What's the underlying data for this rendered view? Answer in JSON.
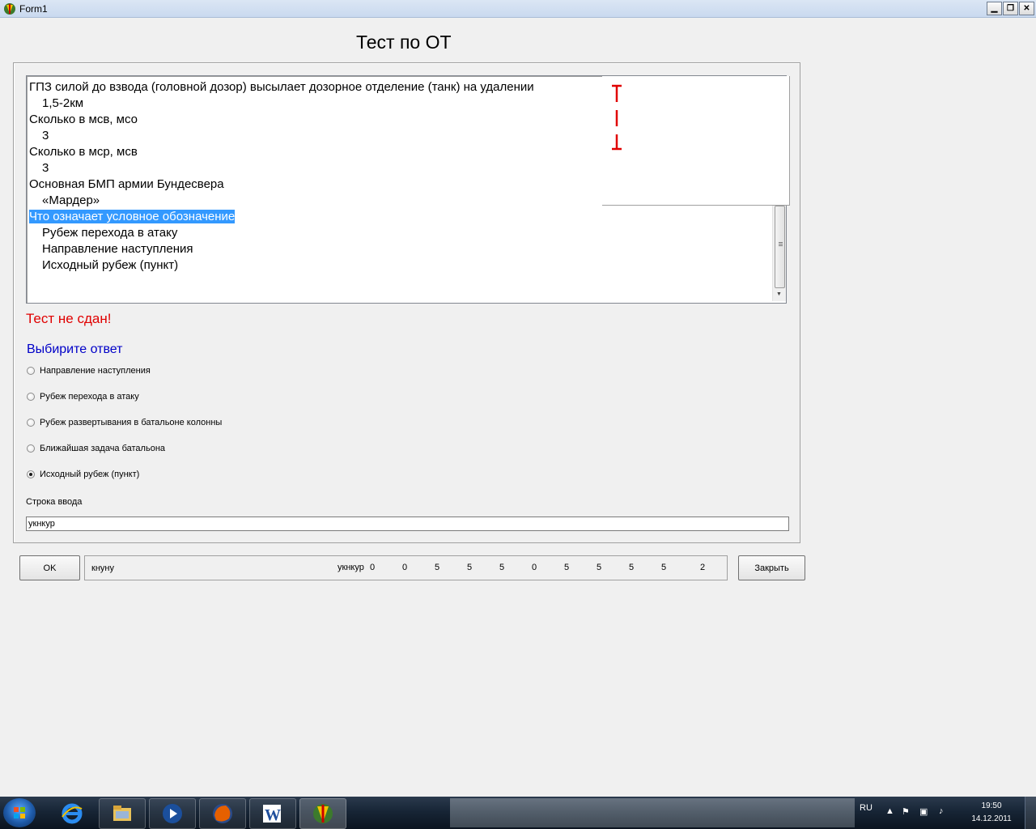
{
  "window": {
    "title": "Form1",
    "controls": {
      "minimize": "▁",
      "restore": "❐",
      "close": "✕"
    }
  },
  "heading": "Тест по ОТ",
  "memo": {
    "lines": [
      {
        "text": "ГПЗ силой до взвода (головной дозор) высылает дозорное отделение (танк) на удалении",
        "indent": false,
        "selected": false
      },
      {
        "text": "1,5-2км",
        "indent": true,
        "selected": false
      },
      {
        "text": "Сколько в мсв, мсо",
        "indent": false,
        "selected": false
      },
      {
        "text": "3",
        "indent": true,
        "selected": false
      },
      {
        "text": "Сколько в мср, мсв",
        "indent": false,
        "selected": false
      },
      {
        "text": "3",
        "indent": true,
        "selected": false
      },
      {
        "text": "Основная БМП армии Бундесвера",
        "indent": false,
        "selected": false
      },
      {
        "text": "«Мардер»",
        "indent": true,
        "selected": false
      },
      {
        "text": "Что означает условное обозначение",
        "indent": false,
        "selected": true
      },
      {
        "text": "Рубеж перехода в атаку",
        "indent": true,
        "selected": false
      },
      {
        "text": "Направление наступления",
        "indent": true,
        "selected": false
      },
      {
        "text": "Исходный рубеж (пункт)",
        "indent": true,
        "selected": false
      }
    ]
  },
  "result": {
    "text": "Тест не сдан!",
    "color": "#e00000"
  },
  "prompt": {
    "text": "Выбирите ответ",
    "color": "#0000c8"
  },
  "answers": [
    {
      "label": "Направление наступления",
      "checked": false
    },
    {
      "label": "Рубеж перехода в атаку",
      "checked": false
    },
    {
      "label": "Рубеж развертывания в батальоне колонны",
      "checked": false
    },
    {
      "label": "Ближайшая задача батальона",
      "checked": false
    },
    {
      "label": "Исходный рубеж (пункт)",
      "checked": true
    }
  ],
  "input": {
    "label": "Строка ввода",
    "value": "укнкур"
  },
  "buttons": {
    "ok": "OK",
    "close": "Закрыть"
  },
  "statusbar": {
    "left_text": "кнуну",
    "right_text": "укнкур",
    "numbers": [
      "0",
      "0",
      "5",
      "5",
      "5",
      "0",
      "5",
      "5",
      "5",
      "5",
      "2"
    ]
  },
  "taskbar": {
    "apps": [
      "internet-explorer",
      "windows-explorer",
      "media-player",
      "firefox",
      "microsoft-word",
      "test-app"
    ],
    "tray_lang": "RU",
    "clock_time": "19:50",
    "clock_date": "14.12.2011"
  },
  "colors": {
    "selection": "#3399ff",
    "symbol": "#e00000"
  }
}
